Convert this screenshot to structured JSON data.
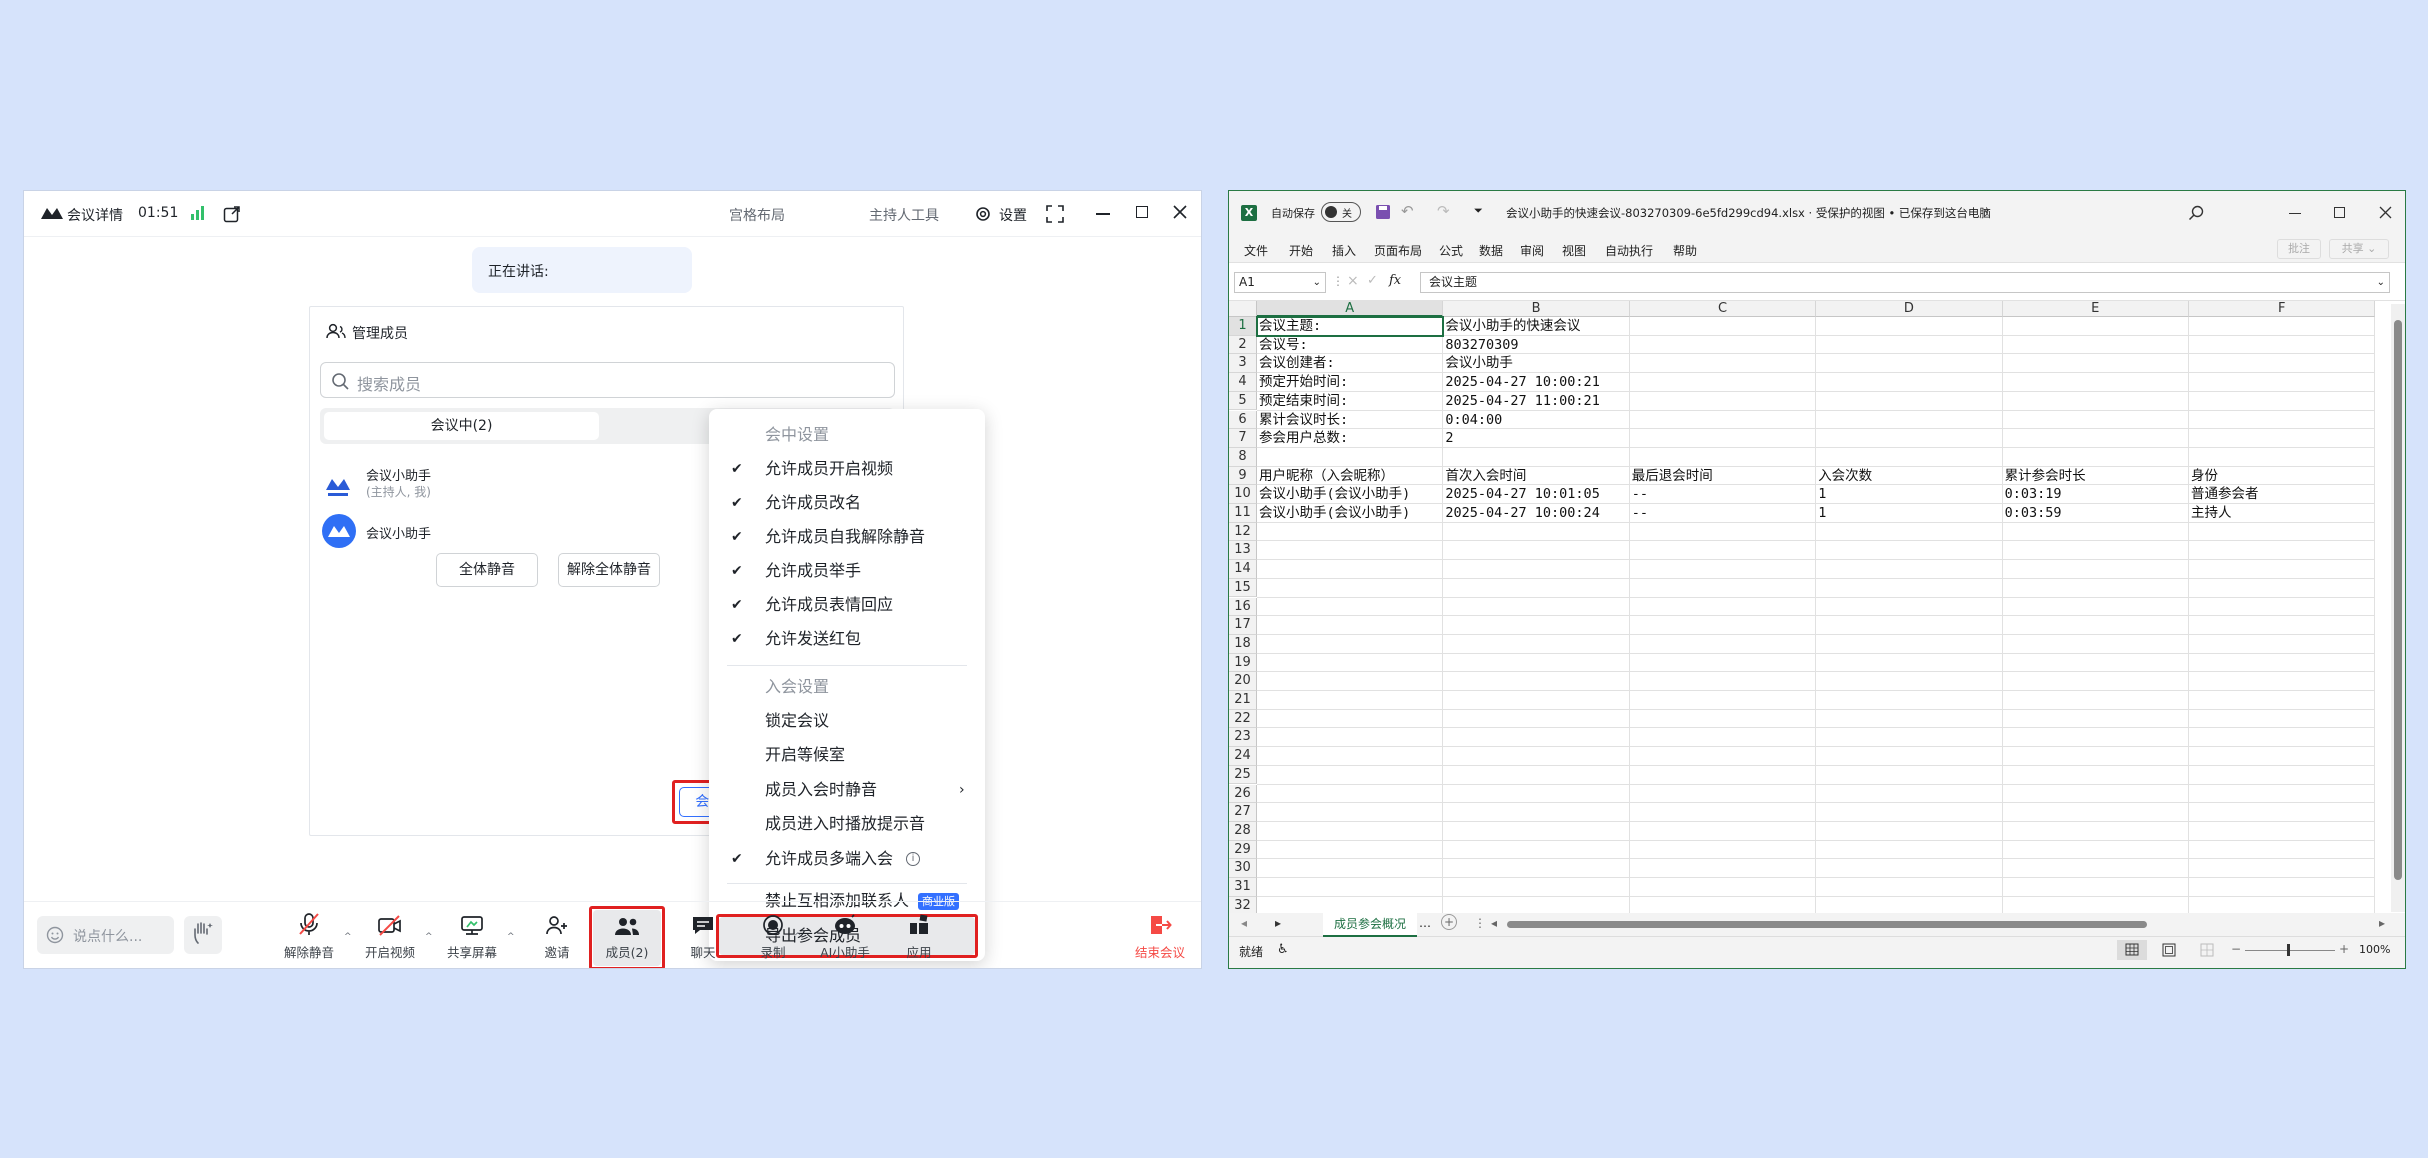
{
  "meeting": {
    "title": "会议详情",
    "timer": "01:51",
    "header_items": [
      "宫格布局",
      "主持人工具",
      "设置"
    ],
    "speaking_label": "正在讲话:",
    "members_panel": {
      "title": "管理成员",
      "search_placeholder": "搜索成员",
      "tab_in_meeting": "会议中(2)",
      "members": [
        {
          "name": "会议小助手",
          "role": "(主持人, 我)"
        },
        {
          "name": "会议小助手",
          "role": ""
        }
      ],
      "mute_all": "全体静音",
      "unmute_all": "解除全体静音",
      "meeting_control": "会议管控"
    },
    "menu": {
      "section_in_meeting": "会中设置",
      "in_meeting_items": [
        {
          "label": "允许成员开启视频",
          "checked": true
        },
        {
          "label": "允许成员改名",
          "checked": true
        },
        {
          "label": "允许成员自我解除静音",
          "checked": true
        },
        {
          "label": "允许成员举手",
          "checked": true
        },
        {
          "label": "允许成员表情回应",
          "checked": true
        },
        {
          "label": "允许发送红包",
          "checked": true
        }
      ],
      "section_join": "入会设置",
      "join_items": [
        {
          "label": "锁定会议",
          "checked": false
        },
        {
          "label": "开启等候室",
          "checked": false
        },
        {
          "label": "成员入会时静音",
          "checked": false
        },
        {
          "label": "成员进入时播放提示音",
          "checked": false
        },
        {
          "label": "允许成员多端入会",
          "checked": true
        }
      ],
      "forbid_contacts": "禁止互相添加联系人",
      "business_badge": "商业版",
      "export_members": "导出参会成员"
    },
    "toolbar": {
      "chat_placeholder": "说点什么...",
      "items": [
        "解除静音",
        "开启视频",
        "共享屏幕",
        "邀请",
        "成员(2)",
        "聊天",
        "录制",
        "AI小助手",
        "应用"
      ],
      "end_meeting": "结束会议"
    },
    "colors": {
      "accent": "#3370ff",
      "highlight": "#e02020",
      "end": "#f54a45"
    }
  },
  "excel": {
    "autosave": "自动保存",
    "autosave_state": "关",
    "file_title": "会议小助手的快速会议-803270309-6e5fd299cd94.xlsx  ·  受保护的视图 • 已保存到这台电脑",
    "menu": [
      "文件",
      "开始",
      "插入",
      "页面布局",
      "公式",
      "数据",
      "审阅",
      "视图",
      "自动执行",
      "帮助"
    ],
    "comment_btn": "批注",
    "share_btn": "共享",
    "name_box": "A1",
    "formula": "会议主题",
    "columns": [
      "A",
      "B",
      "C",
      "D",
      "E",
      "F"
    ],
    "rows": [
      [
        "会议主题:",
        "会议小助手的快速会议",
        "",
        "",
        "",
        ""
      ],
      [
        "会议号:",
        "803270309",
        "",
        "",
        "",
        ""
      ],
      [
        "会议创建者:",
        "会议小助手",
        "",
        "",
        "",
        ""
      ],
      [
        "预定开始时间:",
        "2025-04-27 10:00:21",
        "",
        "",
        "",
        ""
      ],
      [
        "预定结束时间:",
        "2025-04-27 11:00:21",
        "",
        "",
        "",
        ""
      ],
      [
        "累计会议时长:",
        "0:04:00",
        "",
        "",
        "",
        ""
      ],
      [
        "参会用户总数:",
        "2",
        "",
        "",
        "",
        ""
      ],
      [
        "",
        "",
        "",
        "",
        "",
        ""
      ],
      [
        "用户昵称（入会昵称）",
        "首次入会时间",
        "最后退会时间",
        "入会次数",
        "累计参会时长",
        "身份"
      ],
      [
        "会议小助手(会议小助手)",
        "2025-04-27 10:01:05",
        "--",
        "1",
        "0:03:19",
        "普通参会者"
      ],
      [
        "会议小助手(会议小助手)",
        "2025-04-27 10:00:24",
        "--",
        "1",
        "0:03:59",
        "主持人"
      ]
    ],
    "row_count": 32,
    "sheet_tab": "成员参会概况",
    "status_ready": "就绪",
    "zoom": "100%"
  }
}
